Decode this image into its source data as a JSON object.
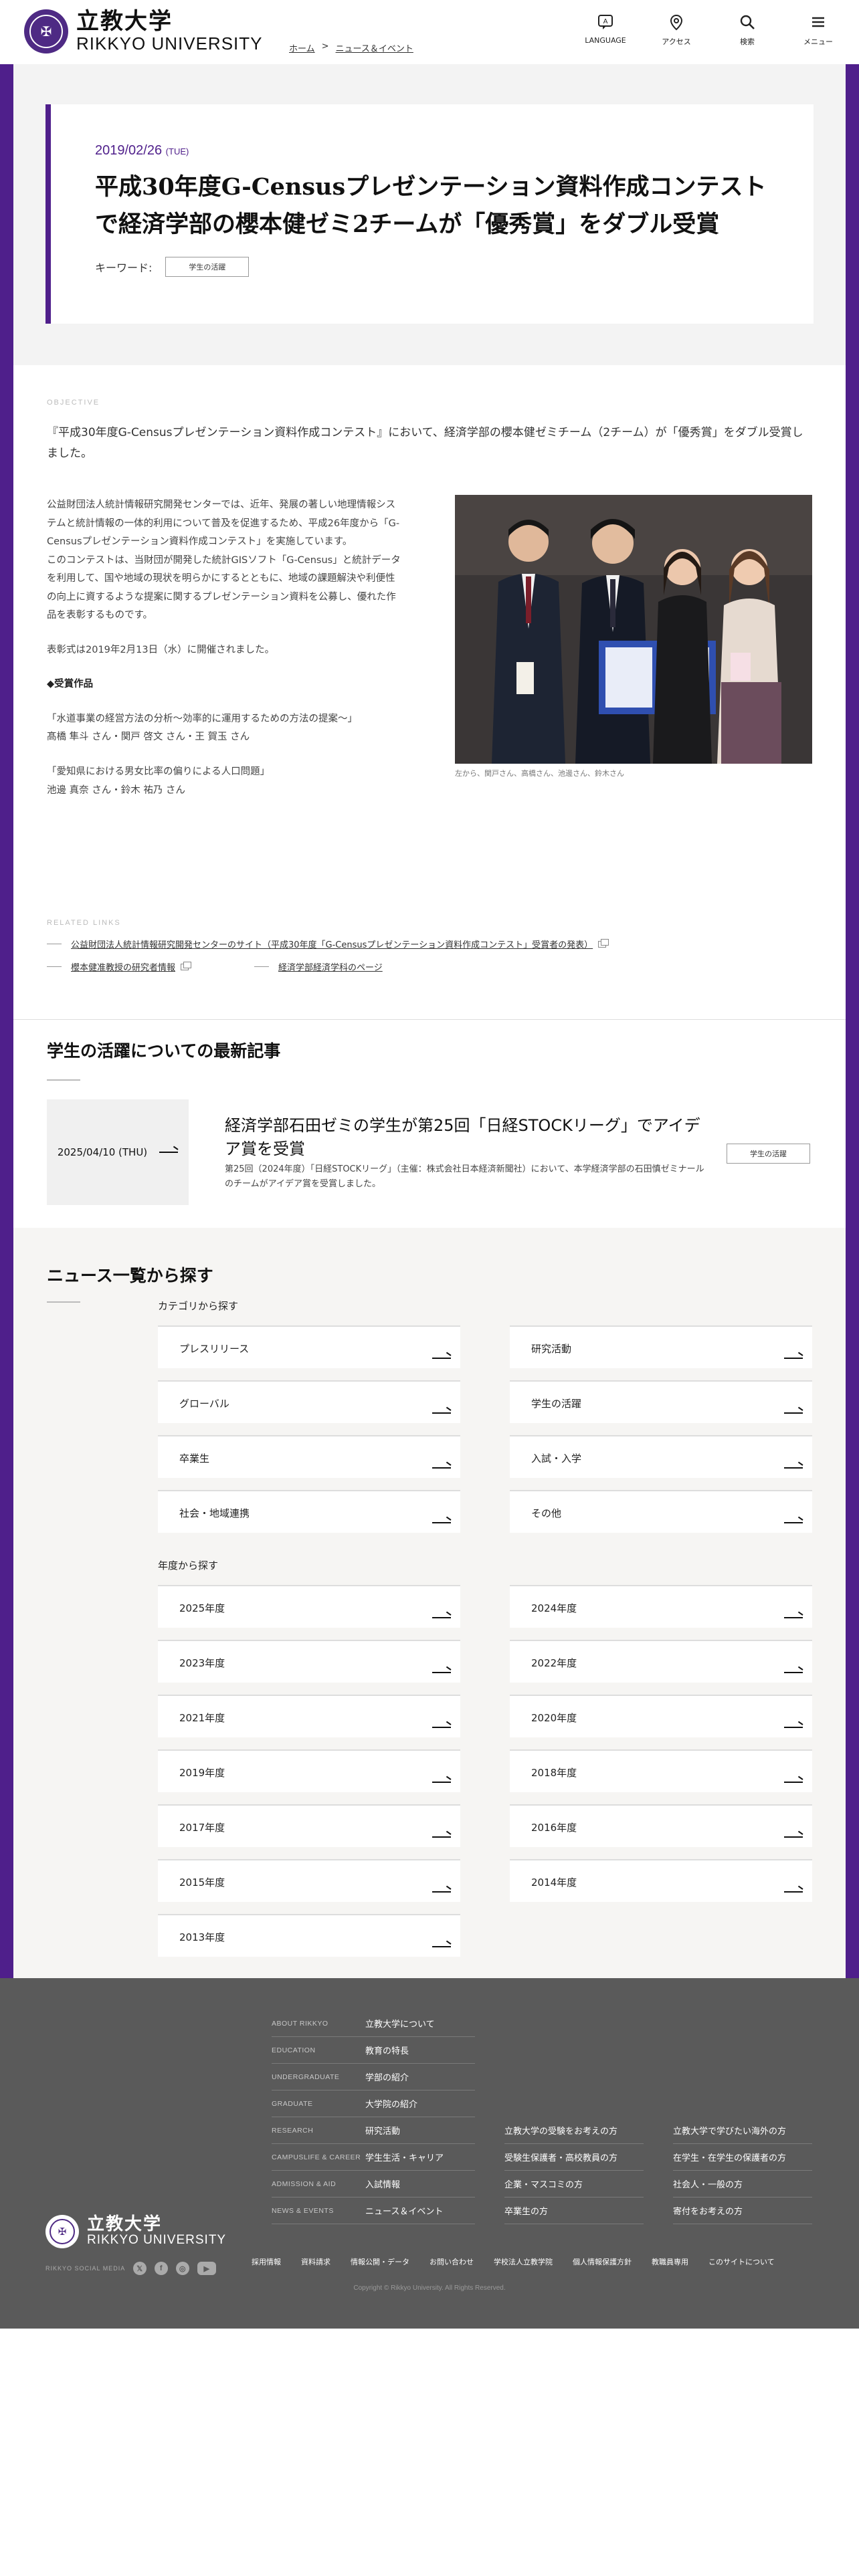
{
  "header": {
    "logo_ja": "立教大学",
    "logo_en": "RIKKYO UNIVERSITY",
    "seal_glyph": "✠",
    "breadcrumb": [
      "ホーム",
      "ニュース＆イベント"
    ],
    "nav": [
      {
        "label": "LANGUAGE",
        "icon": "language-icon"
      },
      {
        "label": "アクセス",
        "icon": "map-pin-icon"
      },
      {
        "label": "検索",
        "icon": "search-icon"
      },
      {
        "label": "メニュー",
        "icon": "menu-icon"
      }
    ]
  },
  "article": {
    "date": "2019/02/26",
    "weekday": "(TUE)",
    "title": "平成30年度G-Censusプレゼンテーション資料作成コンテストで経済学部の櫻本健ゼミ2チームが「優秀賞」をダブル受賞",
    "keyword_label": "キーワード:",
    "keyword_tag": "学生の活躍",
    "objective_label": "OBJECTIVE",
    "lead": "『平成30年度G-Censusプレゼンテーション資料作成コンテスト』において、経済学部の櫻本健ゼミチーム（2チーム）が「優秀賞」をダブル受賞しました。",
    "paragraph1": "公益財団法人統計情報研究開発センターでは、近年、発展の著しい地理情報システムと統計情報の一体的利用について普及を促進するため、平成26年度から「G-Censusプレゼンテーション資料作成コンテスト」を実施しています。",
    "paragraph2": "このコンテストは、当財団が開発した統計GISソフト「G-Census」と統計データを利用して、国や地域の現状を明らかにするとともに、地域の課題解決や利便性の向上に資するような提案に関するプレゼンテーション資料を公募し、優れた作品を表彰するものです。",
    "paragraph3": "表彰式は2019年2月13日（水）に開催されました。",
    "awards_heading": "◆受賞作品",
    "award1_title": "「水道事業の経営方法の分析〜効率的に運用するための方法の提案〜」",
    "award1_names": "髙橋 隼斗 さん・関戸 啓文 さん・王 賀玉 さん",
    "award2_title": "「愛知県における男女比率の偏りによる人口問題」",
    "award2_names": "池邊 真奈 さん・鈴木 祐乃 さん",
    "photo_caption": "左から、関戸さん、高橋さん、池邊さん、鈴木さん"
  },
  "related": {
    "label": "RELATED LINKS",
    "links": [
      "公益財団法人統計情報研究開発センターのサイト（平成30年度「G-Censusプレゼンテーション資料作成コンテスト」受賞者の発表）",
      "櫻本健准教授の研究者情報",
      "経済学部経済学科のページ"
    ]
  },
  "latest": {
    "heading": "学生の活躍についての最新記事",
    "date": "2025/04/10 (THU)",
    "title": "経済学部石田ゼミの学生が第25回「日経STOCKリーグ」でアイデア賞を受賞",
    "desc": "第25回（2024年度）「日経STOCKリーグ」（主催：株式会社日本経済新聞社）において、本学経済学部の石田慎ゼミナールのチームがアイデア賞を受賞しました。",
    "tag": "学生の活躍"
  },
  "news_search": {
    "heading": "ニュース一覧から探す",
    "category_heading": "カテゴリから探す",
    "categories": [
      "プレスリリース",
      "研究活動",
      "グローバル",
      "学生の活躍",
      "卒業生",
      "入試・入学",
      "社会・地域連携",
      "その他"
    ],
    "year_heading": "年度から探す",
    "years": [
      "2025年度",
      "2024年度",
      "2023年度",
      "2022年度",
      "2021年度",
      "2020年度",
      "2019年度",
      "2018年度",
      "2017年度",
      "2016年度",
      "2015年度",
      "2014年度",
      "2013年度"
    ]
  },
  "footer": {
    "menu": [
      {
        "cat": "ABOUT RIKKYO",
        "label": "立教大学について"
      },
      {
        "cat": "EDUCATION",
        "label": "教育の特長"
      },
      {
        "cat": "UNDERGRADUATE",
        "label": "学部の紹介"
      },
      {
        "cat": "GRADUATE",
        "label": "大学院の紹介"
      },
      {
        "cat": "RESEARCH",
        "label": "研究活動"
      },
      {
        "cat": "CAMPUSLIFE & CAREER",
        "label": "学生生活・キャリア"
      },
      {
        "cat": "ADMISSION & AID",
        "label": "入試情報"
      },
      {
        "cat": "NEWS & EVENTS",
        "label": "ニュース＆イベント"
      }
    ],
    "col2": [
      "立教大学の受験をお考えの方",
      "受験生保護者・高校教員の方",
      "企業・マスコミの方",
      "卒業生の方"
    ],
    "col3": [
      "立教大学で学びたい海外の方",
      "在学生・在学生の保護者の方",
      "社会人・一般の方",
      "寄付をお考えの方"
    ],
    "logo_ja": "立教大学",
    "logo_en": "RIKKYO UNIVERSITY",
    "social_label": "RIKKYO SOCIAL MEDIA",
    "bottom_links": [
      "採用情報",
      "資料請求",
      "情報公開・データ",
      "お問い合わせ",
      "学校法人立教学院",
      "個人情報保護方針",
      "教職員専用",
      "このサイトについて"
    ],
    "copyright": "Copyright © Rikkyo University. All Rights Reserved."
  },
  "colors": {
    "brand_purple": "#4f1f8b",
    "footer_grey": "#5a5a5a"
  }
}
